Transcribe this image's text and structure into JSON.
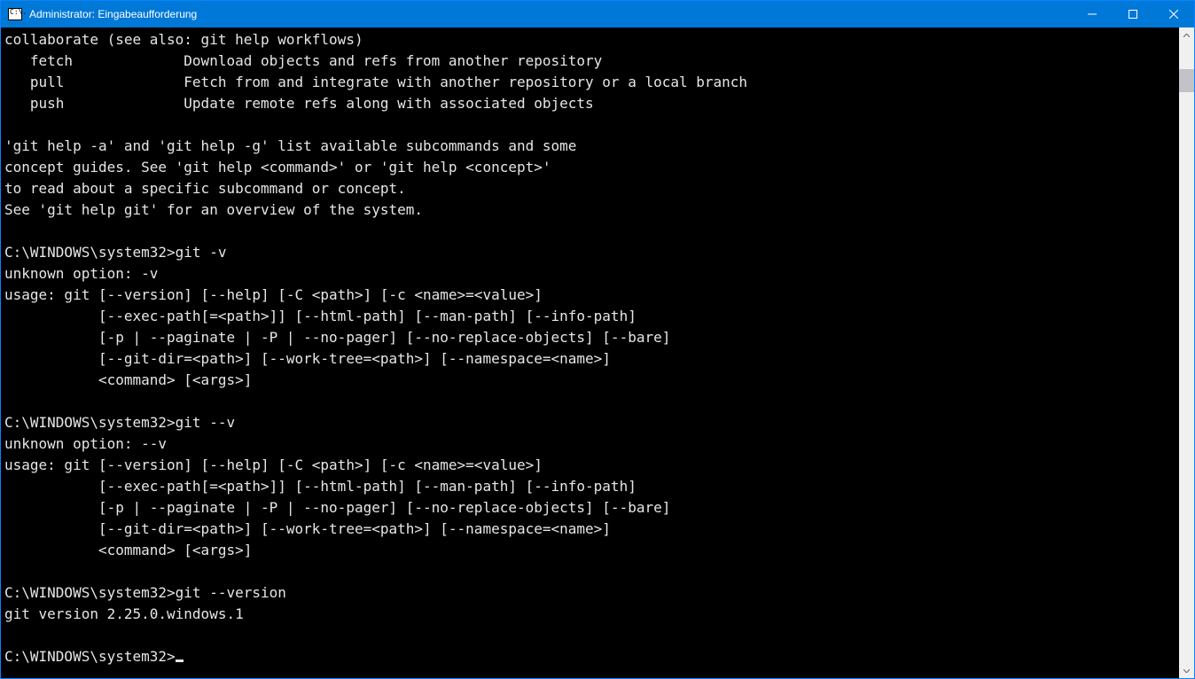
{
  "window": {
    "title": "Administrator: Eingabeaufforderung",
    "icon_text": "C:\\."
  },
  "terminal": {
    "lines": [
      "collaborate (see also: git help workflows)",
      "   fetch             Download objects and refs from another repository",
      "   pull              Fetch from and integrate with another repository or a local branch",
      "   push              Update remote refs along with associated objects",
      "",
      "'git help -a' and 'git help -g' list available subcommands and some",
      "concept guides. See 'git help <command>' or 'git help <concept>'",
      "to read about a specific subcommand or concept.",
      "See 'git help git' for an overview of the system.",
      "",
      "C:\\WINDOWS\\system32>git -v",
      "unknown option: -v",
      "usage: git [--version] [--help] [-C <path>] [-c <name>=<value>]",
      "           [--exec-path[=<path>]] [--html-path] [--man-path] [--info-path]",
      "           [-p | --paginate | -P | --no-pager] [--no-replace-objects] [--bare]",
      "           [--git-dir=<path>] [--work-tree=<path>] [--namespace=<name>]",
      "           <command> [<args>]",
      "",
      "C:\\WINDOWS\\system32>git --v",
      "unknown option: --v",
      "usage: git [--version] [--help] [-C <path>] [-c <name>=<value>]",
      "           [--exec-path[=<path>]] [--html-path] [--man-path] [--info-path]",
      "           [-p | --paginate | -P | --no-pager] [--no-replace-objects] [--bare]",
      "           [--git-dir=<path>] [--work-tree=<path>] [--namespace=<name>]",
      "           <command> [<args>]",
      "",
      "C:\\WINDOWS\\system32>git --version",
      "git version 2.25.0.windows.1",
      ""
    ],
    "prompt": "C:\\WINDOWS\\system32>"
  }
}
